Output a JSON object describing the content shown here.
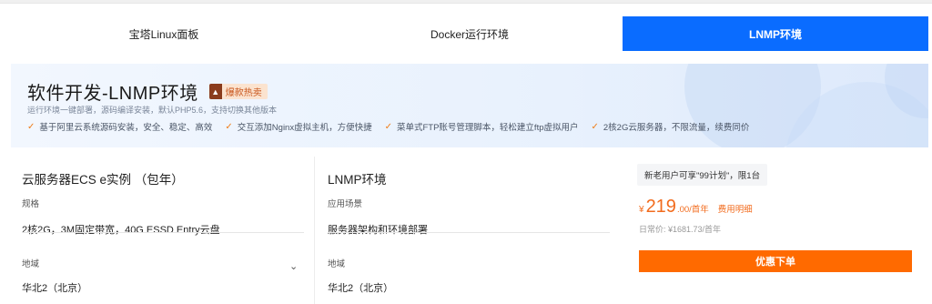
{
  "tabs": [
    {
      "label": "宝塔Linux面板",
      "active": false
    },
    {
      "label": "Docker运行环境",
      "active": false
    },
    {
      "label": "LNMP环境",
      "active": true
    }
  ],
  "banner": {
    "title": "软件开发-LNMP环境",
    "badge": "爆款热卖",
    "badge_icon": "fire-icon",
    "subtitle": "运行环境一键部署，源码编译安装，默认PHP5.6，支持切换其他版本",
    "features": [
      "基于阿里云系统源码安装，安全、稳定、高效",
      "交互添加Nginx虚拟主机，方便快捷",
      "菜单式FTP账号管理脚本，轻松建立ftp虚拟用户",
      "2核2G云服务器，不限流量，续费同价"
    ]
  },
  "server": {
    "title": "云服务器ECS e实例 （包年）",
    "spec_label": "规格",
    "spec_value": "2核2G，3M固定带宽，40G ESSD Entry云盘",
    "region_label": "地域",
    "region_value": "华北2（北京）"
  },
  "lnmp": {
    "title": "LNMP环境",
    "scene_label": "应用场景",
    "scene_value": "服务器架构和环境部署",
    "region_label": "地域",
    "region_value": "华北2（北京）"
  },
  "pricing": {
    "promo": "新老用户可享\"99计划\"，限1台",
    "currency": "¥",
    "price": "219",
    "unit": ".00/首年",
    "detail_link": "费用明细",
    "original": "日常价: ¥1681.73/首年",
    "order_button": "优惠下单"
  },
  "colors": {
    "accent_blue": "#0a6cff",
    "accent_orange": "#ff6a00"
  }
}
